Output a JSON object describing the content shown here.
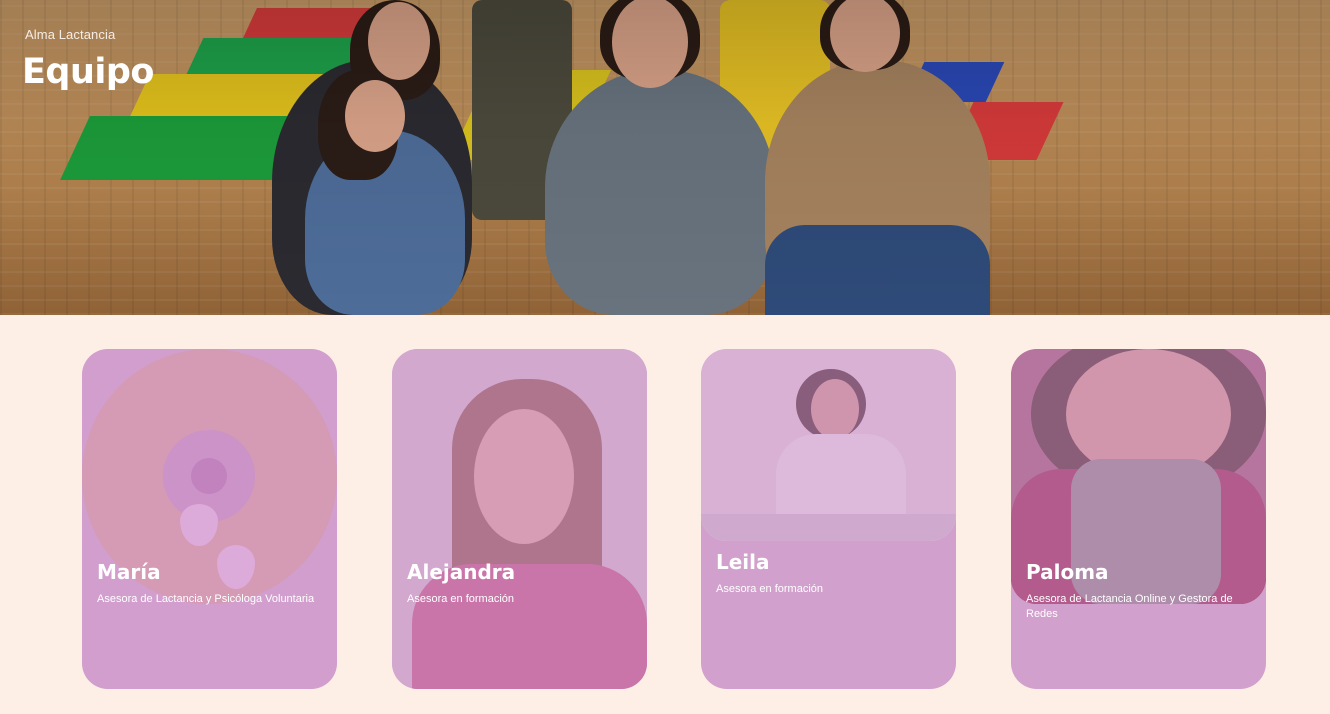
{
  "header": {
    "breadcrumb": "Alma Lactancia",
    "title": "Equipo"
  },
  "team": [
    {
      "name": "María",
      "role": "Asesora de Lactancia y Psicóloga Voluntaria"
    },
    {
      "name": "Alejandra",
      "role": "Asesora en formación"
    },
    {
      "name": "Leila",
      "role": "Asesora en formación"
    },
    {
      "name": "Paloma",
      "role": "Asesora de Lactancia Online y Gestora de Redes"
    }
  ],
  "colors": {
    "page_background": "#fdeee6",
    "card_tint": "#d1a0cc",
    "text_on_card": "#ffffff"
  }
}
